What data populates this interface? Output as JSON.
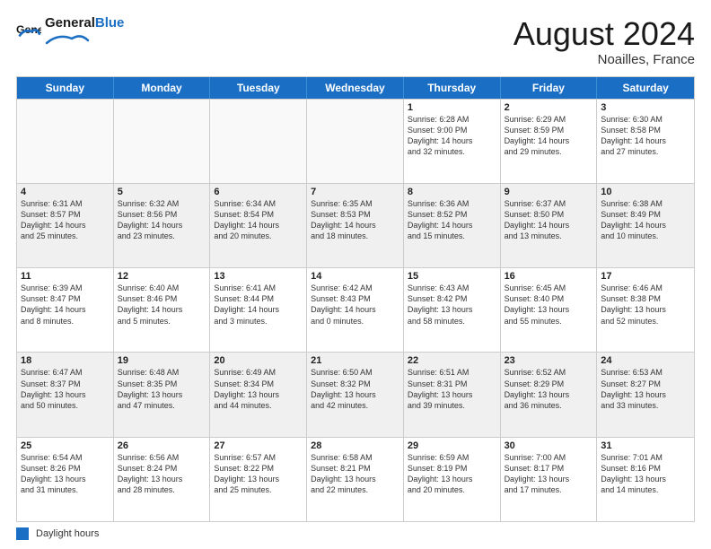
{
  "header": {
    "logo_general": "General",
    "logo_blue": "Blue",
    "month_year": "August 2024",
    "location": "Noailles, France"
  },
  "days_of_week": [
    "Sunday",
    "Monday",
    "Tuesday",
    "Wednesday",
    "Thursday",
    "Friday",
    "Saturday"
  ],
  "weeks": [
    [
      {
        "day": "",
        "text": "",
        "empty": true
      },
      {
        "day": "",
        "text": "",
        "empty": true
      },
      {
        "day": "",
        "text": "",
        "empty": true
      },
      {
        "day": "",
        "text": "",
        "empty": true
      },
      {
        "day": "1",
        "text": "Sunrise: 6:28 AM\nSunset: 9:00 PM\nDaylight: 14 hours\nand 32 minutes.",
        "empty": false
      },
      {
        "day": "2",
        "text": "Sunrise: 6:29 AM\nSunset: 8:59 PM\nDaylight: 14 hours\nand 29 minutes.",
        "empty": false
      },
      {
        "day": "3",
        "text": "Sunrise: 6:30 AM\nSunset: 8:58 PM\nDaylight: 14 hours\nand 27 minutes.",
        "empty": false
      }
    ],
    [
      {
        "day": "4",
        "text": "Sunrise: 6:31 AM\nSunset: 8:57 PM\nDaylight: 14 hours\nand 25 minutes.",
        "empty": false
      },
      {
        "day": "5",
        "text": "Sunrise: 6:32 AM\nSunset: 8:56 PM\nDaylight: 14 hours\nand 23 minutes.",
        "empty": false
      },
      {
        "day": "6",
        "text": "Sunrise: 6:34 AM\nSunset: 8:54 PM\nDaylight: 14 hours\nand 20 minutes.",
        "empty": false
      },
      {
        "day": "7",
        "text": "Sunrise: 6:35 AM\nSunset: 8:53 PM\nDaylight: 14 hours\nand 18 minutes.",
        "empty": false
      },
      {
        "day": "8",
        "text": "Sunrise: 6:36 AM\nSunset: 8:52 PM\nDaylight: 14 hours\nand 15 minutes.",
        "empty": false
      },
      {
        "day": "9",
        "text": "Sunrise: 6:37 AM\nSunset: 8:50 PM\nDaylight: 14 hours\nand 13 minutes.",
        "empty": false
      },
      {
        "day": "10",
        "text": "Sunrise: 6:38 AM\nSunset: 8:49 PM\nDaylight: 14 hours\nand 10 minutes.",
        "empty": false
      }
    ],
    [
      {
        "day": "11",
        "text": "Sunrise: 6:39 AM\nSunset: 8:47 PM\nDaylight: 14 hours\nand 8 minutes.",
        "empty": false
      },
      {
        "day": "12",
        "text": "Sunrise: 6:40 AM\nSunset: 8:46 PM\nDaylight: 14 hours\nand 5 minutes.",
        "empty": false
      },
      {
        "day": "13",
        "text": "Sunrise: 6:41 AM\nSunset: 8:44 PM\nDaylight: 14 hours\nand 3 minutes.",
        "empty": false
      },
      {
        "day": "14",
        "text": "Sunrise: 6:42 AM\nSunset: 8:43 PM\nDaylight: 14 hours\nand 0 minutes.",
        "empty": false
      },
      {
        "day": "15",
        "text": "Sunrise: 6:43 AM\nSunset: 8:42 PM\nDaylight: 13 hours\nand 58 minutes.",
        "empty": false
      },
      {
        "day": "16",
        "text": "Sunrise: 6:45 AM\nSunset: 8:40 PM\nDaylight: 13 hours\nand 55 minutes.",
        "empty": false
      },
      {
        "day": "17",
        "text": "Sunrise: 6:46 AM\nSunset: 8:38 PM\nDaylight: 13 hours\nand 52 minutes.",
        "empty": false
      }
    ],
    [
      {
        "day": "18",
        "text": "Sunrise: 6:47 AM\nSunset: 8:37 PM\nDaylight: 13 hours\nand 50 minutes.",
        "empty": false
      },
      {
        "day": "19",
        "text": "Sunrise: 6:48 AM\nSunset: 8:35 PM\nDaylight: 13 hours\nand 47 minutes.",
        "empty": false
      },
      {
        "day": "20",
        "text": "Sunrise: 6:49 AM\nSunset: 8:34 PM\nDaylight: 13 hours\nand 44 minutes.",
        "empty": false
      },
      {
        "day": "21",
        "text": "Sunrise: 6:50 AM\nSunset: 8:32 PM\nDaylight: 13 hours\nand 42 minutes.",
        "empty": false
      },
      {
        "day": "22",
        "text": "Sunrise: 6:51 AM\nSunset: 8:31 PM\nDaylight: 13 hours\nand 39 minutes.",
        "empty": false
      },
      {
        "day": "23",
        "text": "Sunrise: 6:52 AM\nSunset: 8:29 PM\nDaylight: 13 hours\nand 36 minutes.",
        "empty": false
      },
      {
        "day": "24",
        "text": "Sunrise: 6:53 AM\nSunset: 8:27 PM\nDaylight: 13 hours\nand 33 minutes.",
        "empty": false
      }
    ],
    [
      {
        "day": "25",
        "text": "Sunrise: 6:54 AM\nSunset: 8:26 PM\nDaylight: 13 hours\nand 31 minutes.",
        "empty": false
      },
      {
        "day": "26",
        "text": "Sunrise: 6:56 AM\nSunset: 8:24 PM\nDaylight: 13 hours\nand 28 minutes.",
        "empty": false
      },
      {
        "day": "27",
        "text": "Sunrise: 6:57 AM\nSunset: 8:22 PM\nDaylight: 13 hours\nand 25 minutes.",
        "empty": false
      },
      {
        "day": "28",
        "text": "Sunrise: 6:58 AM\nSunset: 8:21 PM\nDaylight: 13 hours\nand 22 minutes.",
        "empty": false
      },
      {
        "day": "29",
        "text": "Sunrise: 6:59 AM\nSunset: 8:19 PM\nDaylight: 13 hours\nand 20 minutes.",
        "empty": false
      },
      {
        "day": "30",
        "text": "Sunrise: 7:00 AM\nSunset: 8:17 PM\nDaylight: 13 hours\nand 17 minutes.",
        "empty": false
      },
      {
        "day": "31",
        "text": "Sunrise: 7:01 AM\nSunset: 8:16 PM\nDaylight: 13 hours\nand 14 minutes.",
        "empty": false
      }
    ]
  ],
  "footer": {
    "legend_label": "Daylight hours"
  }
}
